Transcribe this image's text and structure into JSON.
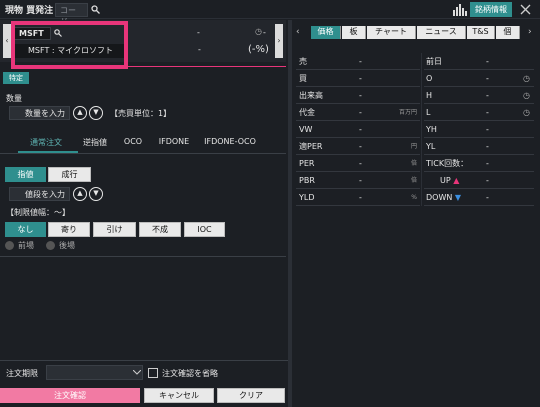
{
  "header": {
    "title": "現物 買発注",
    "code_placeholder": "コード",
    "market_info_label": "銘柄情報"
  },
  "symbol": {
    "code": "MSFT",
    "name": "MSFT : マイクロソフト",
    "price": "-",
    "change": "-",
    "change_pct": "(-%)",
    "dash": "-"
  },
  "specific_badge": "特定",
  "quantity": {
    "label": "数量",
    "placeholder": "数量を入力",
    "unit": "【売買単位：1】"
  },
  "order_types": [
    "通常注文",
    "逆指値",
    "OCO",
    "IFDONE",
    "IFDONE-OCO"
  ],
  "price_mode": {
    "limit": "指値",
    "market": "成行",
    "price_placeholder": "値段を入力"
  },
  "price_limit_label": "【制限値幅：～】",
  "conditions": [
    "なし",
    "寄り",
    "引け",
    "不成",
    "IOC"
  ],
  "session": {
    "morning": "前場",
    "afternoon": "後場"
  },
  "expiry": {
    "label": "注文期限",
    "skip_label": "注文確認を省略"
  },
  "actions": {
    "confirm": "注文確認",
    "cancel": "キャンセル",
    "clear": "クリア"
  },
  "right_tabs": [
    "価格",
    "板",
    "チャート",
    "ニュース",
    "T&S",
    "個"
  ],
  "left_stats": [
    {
      "label": "売",
      "value": "-",
      "unit": ""
    },
    {
      "label": "買",
      "value": "-",
      "unit": ""
    },
    {
      "label": "出来高",
      "value": "-",
      "unit": ""
    },
    {
      "label": "代金",
      "value": "-",
      "unit": "百万円"
    },
    {
      "label": "VW",
      "value": "-",
      "unit": ""
    },
    {
      "label": "適PER",
      "value": "-",
      "unit": "円"
    },
    {
      "label": "PER",
      "value": "-",
      "unit": "倍"
    },
    {
      "label": "PBR",
      "value": "-",
      "unit": "倍"
    },
    {
      "label": "YLD",
      "value": "-",
      "unit": "%"
    }
  ],
  "right_stats": [
    {
      "label": "前日",
      "value": "-"
    },
    {
      "label": "O",
      "value": "-"
    },
    {
      "label": "H",
      "value": "-"
    },
    {
      "label": "L",
      "value": "-"
    },
    {
      "label": "YH",
      "value": "-"
    },
    {
      "label": "YL",
      "value": "-"
    },
    {
      "label": "TICK回数：",
      "value": "-"
    },
    {
      "label": "UP",
      "value": "-"
    },
    {
      "label": "DOWN",
      "value": "-"
    }
  ],
  "colors": {
    "accent": "#2f8f8e",
    "highlight": "#e8357a",
    "confirm": "#f27aa3"
  }
}
